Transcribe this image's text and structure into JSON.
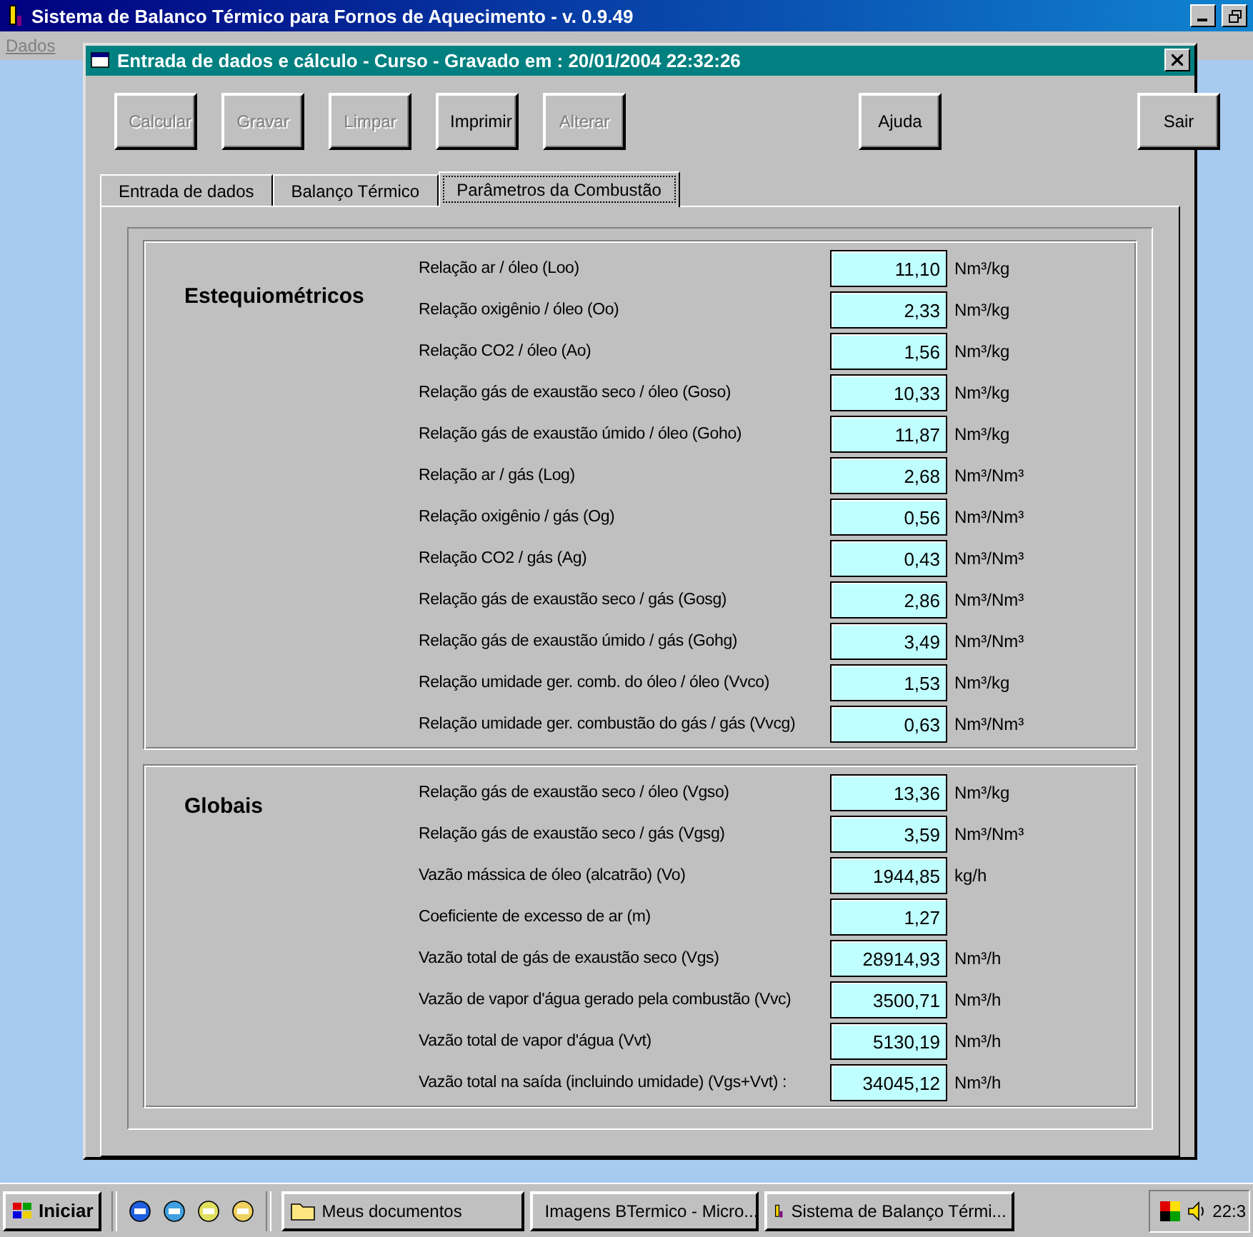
{
  "main_window": {
    "title": "Sistema de Balanco Térmico para Fornos de Aquecimento - v. 0.9.49",
    "menu": [
      {
        "label": "Dados",
        "disabled": true
      }
    ]
  },
  "dialog": {
    "title": "Entrada de dados e cálculo - Curso - Gravado em : 20/01/2004 22:32:26",
    "buttons": [
      {
        "label": "Calcular",
        "disabled": true
      },
      {
        "label": "Gravar",
        "disabled": true
      },
      {
        "label": "Limpar",
        "disabled": true
      },
      {
        "label": "Imprimir",
        "disabled": false
      },
      {
        "label": "Alterar",
        "disabled": true
      },
      {
        "label": "Ajuda",
        "disabled": false
      },
      {
        "label": "Sair",
        "disabled": false
      }
    ],
    "tabs": [
      {
        "label": "Entrada de dados",
        "selected": false
      },
      {
        "label": "Balanço Térmico",
        "selected": false
      },
      {
        "label": "Parâmetros da Combustão",
        "selected": true
      }
    ],
    "sections": [
      {
        "title": "Estequiométricos",
        "rows": [
          {
            "label": "Relação ar / óleo  (Loo)",
            "value": "11,10",
            "unit": "Nm³/kg"
          },
          {
            "label": "Relação oxigênio / óleo  (Oo)",
            "value": "2,33",
            "unit": "Nm³/kg"
          },
          {
            "label": "Relação CO2 / óleo  (Ao)",
            "value": "1,56",
            "unit": "Nm³/kg"
          },
          {
            "label": "Relação gás de exaustão seco / óleo  (Goso)",
            "value": "10,33",
            "unit": "Nm³/kg"
          },
          {
            "label": "Relação gás de exaustão úmido / óleo  (Goho)",
            "value": "11,87",
            "unit": "Nm³/kg"
          },
          {
            "label": "Relação ar / gás  (Log)",
            "value": "2,68",
            "unit": "Nm³/Nm³"
          },
          {
            "label": "Relação oxigênio / gás  (Og)",
            "value": "0,56",
            "unit": "Nm³/Nm³"
          },
          {
            "label": "Relação CO2 / gás  (Ag)",
            "value": "0,43",
            "unit": "Nm³/Nm³"
          },
          {
            "label": "Relação gás de exaustão seco / gás  (Gosg)",
            "value": "2,86",
            "unit": "Nm³/Nm³"
          },
          {
            "label": "Relação gás de exaustão úmido / gás  (Gohg)",
            "value": "3,49",
            "unit": "Nm³/Nm³"
          },
          {
            "label": "Relação umidade ger. comb. do óleo / óleo  (Vvco)",
            "value": "1,53",
            "unit": "Nm³/kg"
          },
          {
            "label": "Relação umidade ger. combustão do gás / gás (Vvcg)",
            "value": "0,63",
            "unit": "Nm³/Nm³"
          }
        ]
      },
      {
        "title": "Globais",
        "rows": [
          {
            "label": "Relação gás de exaustão seco / óleo  (Vgso)",
            "value": "13,36",
            "unit": "Nm³/kg"
          },
          {
            "label": "Relação gás de exaustão seco / gás  (Vgsg)",
            "value": "3,59",
            "unit": "Nm³/Nm³"
          },
          {
            "label": "Vazão mássica de óleo (alcatrão)  (Vo)",
            "value": "1944,85",
            "unit": "kg/h"
          },
          {
            "label": "Coeficiente de excesso de ar  (m)",
            "value": "1,27"
          },
          {
            "label": "Vazão total de gás de exaustão seco  (Vgs)",
            "value": "28914,93",
            "unit": "Nm³/h"
          },
          {
            "label": "Vazão de vapor d'água gerado pela combustão  (Vvc)",
            "value": "3500,71",
            "unit": "Nm³/h"
          },
          {
            "label": "Vazão total de vapor d'água  (Vvt)",
            "value": "5130,19",
            "unit": "Nm³/h"
          },
          {
            "label": "Vazão total na saída (incluindo umidade) (Vgs+Vvt) :",
            "value": "34045,12",
            "unit": "Nm³/h"
          }
        ]
      }
    ]
  },
  "taskbar": {
    "start": "Iniciar",
    "tasks": [
      {
        "label": "Meus documentos",
        "kind": "folder"
      },
      {
        "label": "Imagens BTermico - Micro...",
        "kind": "document"
      },
      {
        "label": "Sistema de Balanço Térmi...",
        "kind": "app"
      }
    ],
    "clock": "22:3"
  }
}
